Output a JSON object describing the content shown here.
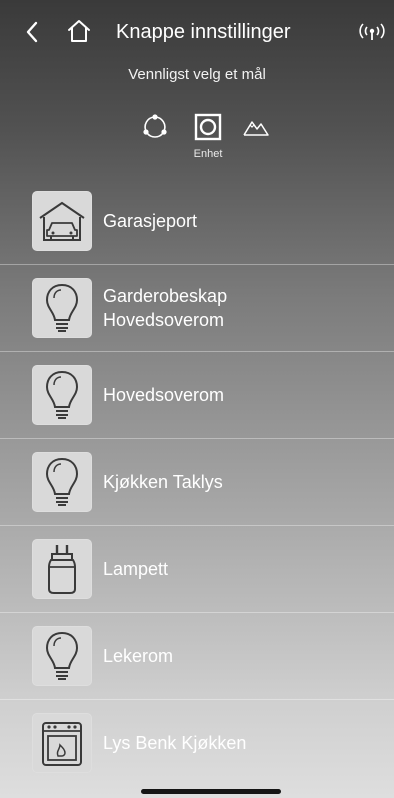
{
  "header": {
    "title": "Knappe innstillinger",
    "back_icon": "chevron-left-icon",
    "home_icon": "home-icon",
    "status_icon": "signal-broadcast-icon"
  },
  "subtitle": "Vennligst velg et mål",
  "target_selector": {
    "options": [
      {
        "icon": "group-icon",
        "label": ""
      },
      {
        "icon": "device-icon",
        "label": "Enhet"
      },
      {
        "icon": "scene-icon",
        "label": ""
      }
    ],
    "selected": "Enhet"
  },
  "devices": [
    {
      "label": "Garasjeport",
      "icon": "garage-icon"
    },
    {
      "label": "Garderobeskap\nHovedsoverom",
      "icon": "bulb-icon"
    },
    {
      "label": "Hovedsoverom",
      "icon": "bulb-icon"
    },
    {
      "label": "Kjøkken Taklys",
      "icon": "bulb-icon"
    },
    {
      "label": "Lampett",
      "icon": "plug-icon"
    },
    {
      "label": "Lekerom",
      "icon": "bulb-icon"
    },
    {
      "label": "Lys Benk Kjøkken",
      "icon": "oven-icon"
    }
  ],
  "colors": {
    "tile_bg": "#d9d9d9",
    "icon_stroke": "#3a3a3a",
    "text": "#ffffff"
  }
}
